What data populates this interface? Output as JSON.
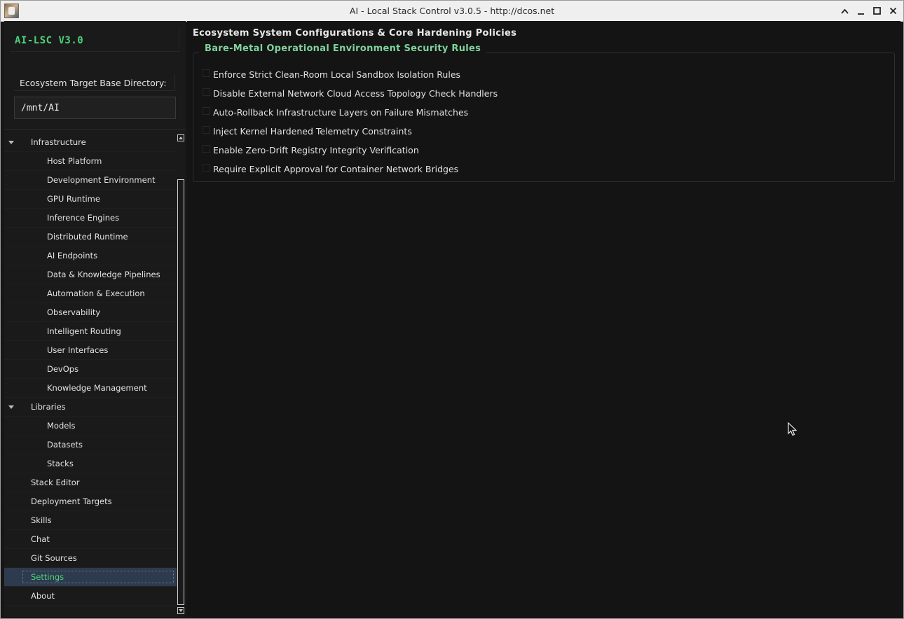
{
  "window": {
    "title": "AI - Local Stack Control v3.0.5 - http://dcos.net",
    "controls": [
      "chevron-up",
      "minimize",
      "maximize",
      "close"
    ]
  },
  "sidebar": {
    "brand": "AI-LSC V3.0",
    "directory_label": "Ecosystem Target Base Directory:",
    "directory_value": "/mnt/AI",
    "selected": "Settings",
    "tree": {
      "infrastructure": {
        "label": "Infrastructure",
        "children": [
          "Host Platform",
          "Development Environment",
          "GPU Runtime",
          "Inference Engines",
          "Distributed Runtime",
          "AI Endpoints",
          "Data & Knowledge Pipelines",
          "Automation & Execution",
          "Observability",
          "Intelligent Routing",
          "User Interfaces",
          "DevOps",
          "Knowledge Management"
        ]
      },
      "libraries": {
        "label": "Libraries",
        "children": [
          "Models",
          "Datasets",
          "Stacks"
        ]
      },
      "top_items": [
        "Stack Editor",
        "Deployment Targets",
        "Skills",
        "Chat",
        "Git Sources",
        "Settings",
        "About"
      ]
    }
  },
  "main": {
    "title": "Ecosystem System Configurations & Core Hardening Policies",
    "group_title": "Bare-Metal Operational Environment Security Rules",
    "rules": [
      "Enforce Strict Clean-Room Local Sandbox Isolation Rules",
      "Disable External Network Cloud Access Topology Check Handlers",
      "Auto-Rollback Infrastructure Layers on Failure Mismatches",
      "Inject Kernel Hardened Telemetry Constraints",
      "Enable Zero-Drift Registry Integrity Verification",
      "Require Explicit Approval for Container Network Bridges"
    ]
  },
  "colors": {
    "accent": "#4cd27a",
    "group_title": "#7fd39b",
    "selection_bg": "#2e3b4e",
    "background": "#141414"
  }
}
